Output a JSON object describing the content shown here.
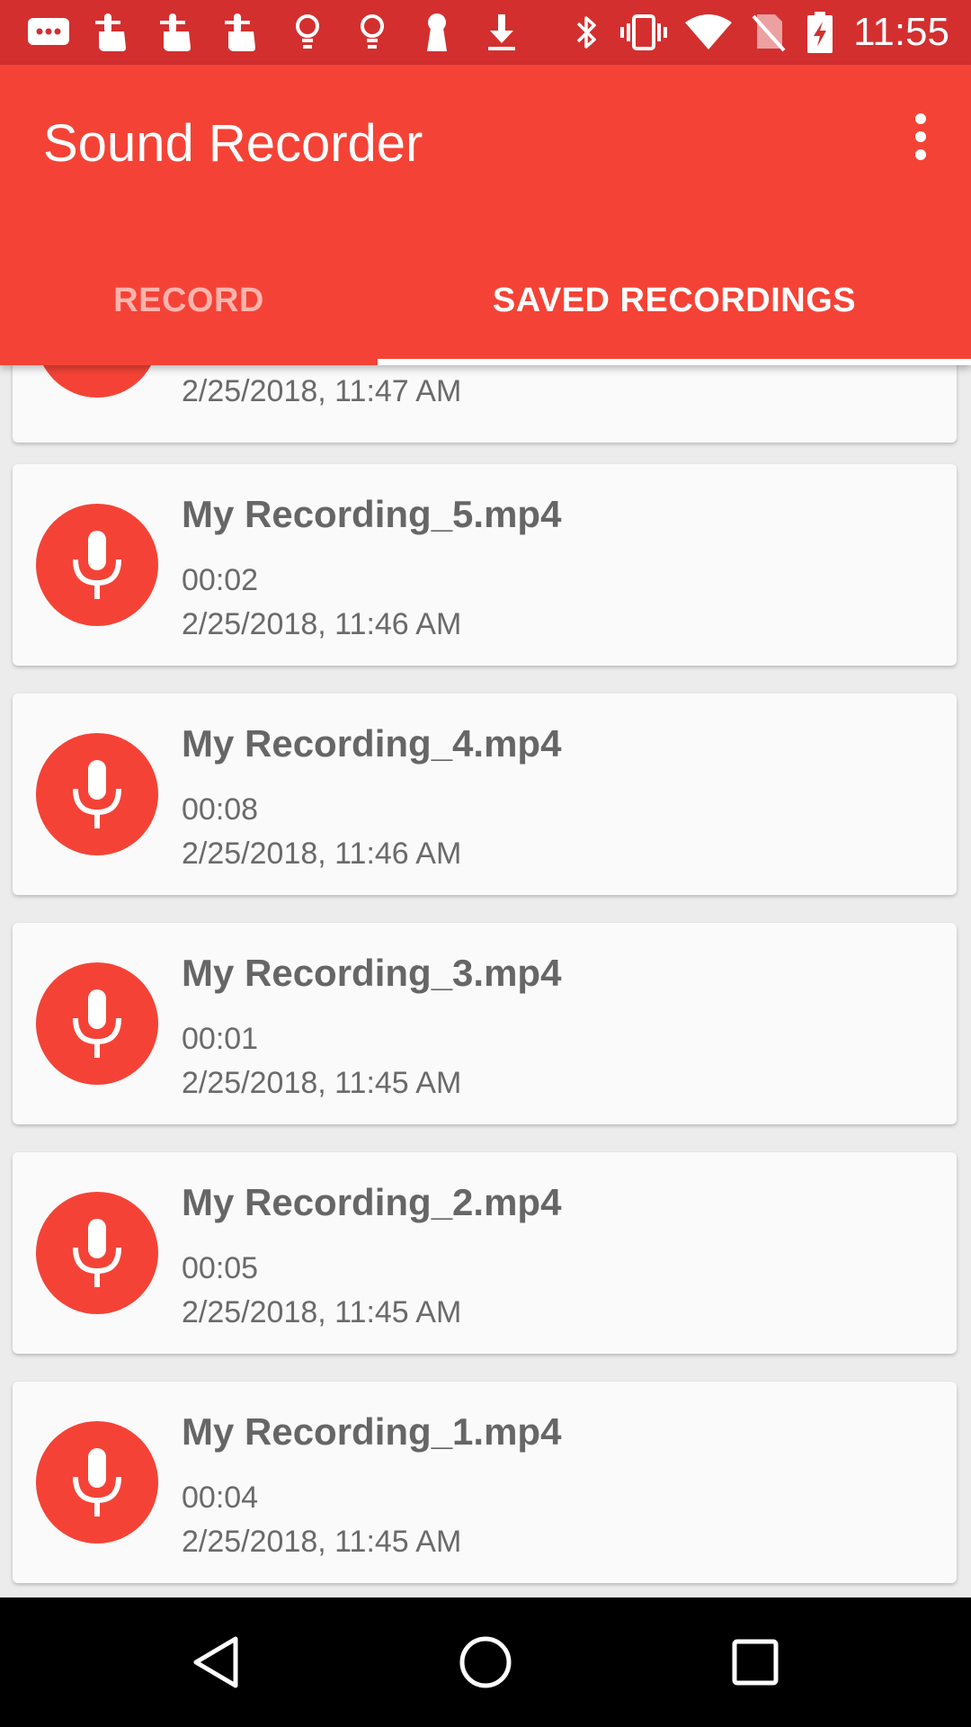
{
  "status_bar": {
    "time": "11:55",
    "icons": [
      "message-icon",
      "touch-icon",
      "touch-icon",
      "touch-icon",
      "lightbulb-icon",
      "lightbulb-icon",
      "keyhole-icon",
      "download-icon",
      "bluetooth-icon",
      "vibrate-icon",
      "wifi-icon",
      "no-sim-icon",
      "battery-charging-icon"
    ]
  },
  "app_bar": {
    "title": "Sound Recorder",
    "menu_icon": "more-vert-icon"
  },
  "tabs": [
    {
      "label": "RECORD",
      "selected": false
    },
    {
      "label": "SAVED RECORDINGS",
      "selected": true
    }
  ],
  "recordings": {
    "partial_top": {
      "date": "2/25/2018, 11:47 AM"
    },
    "items": [
      {
        "name": "My Recording_5.mp4",
        "duration": "00:02",
        "date": "2/25/2018, 11:46 AM"
      },
      {
        "name": "My Recording_4.mp4",
        "duration": "00:08",
        "date": "2/25/2018, 11:46 AM"
      },
      {
        "name": "My Recording_3.mp4",
        "duration": "00:01",
        "date": "2/25/2018, 11:45 AM"
      },
      {
        "name": "My Recording_2.mp4",
        "duration": "00:05",
        "date": "2/25/2018, 11:45 AM"
      },
      {
        "name": "My Recording_1.mp4",
        "duration": "00:04",
        "date": "2/25/2018, 11:45 AM"
      }
    ]
  },
  "nav_bar": {
    "buttons": [
      "back-icon",
      "home-icon",
      "recents-icon"
    ]
  },
  "colors": {
    "primary": "#f44336",
    "primary_dark": "#d32f2f",
    "tab_inactive": "#ffb3ad",
    "card_bg": "#fafafa",
    "text_secondary": "#6a6a6a"
  }
}
